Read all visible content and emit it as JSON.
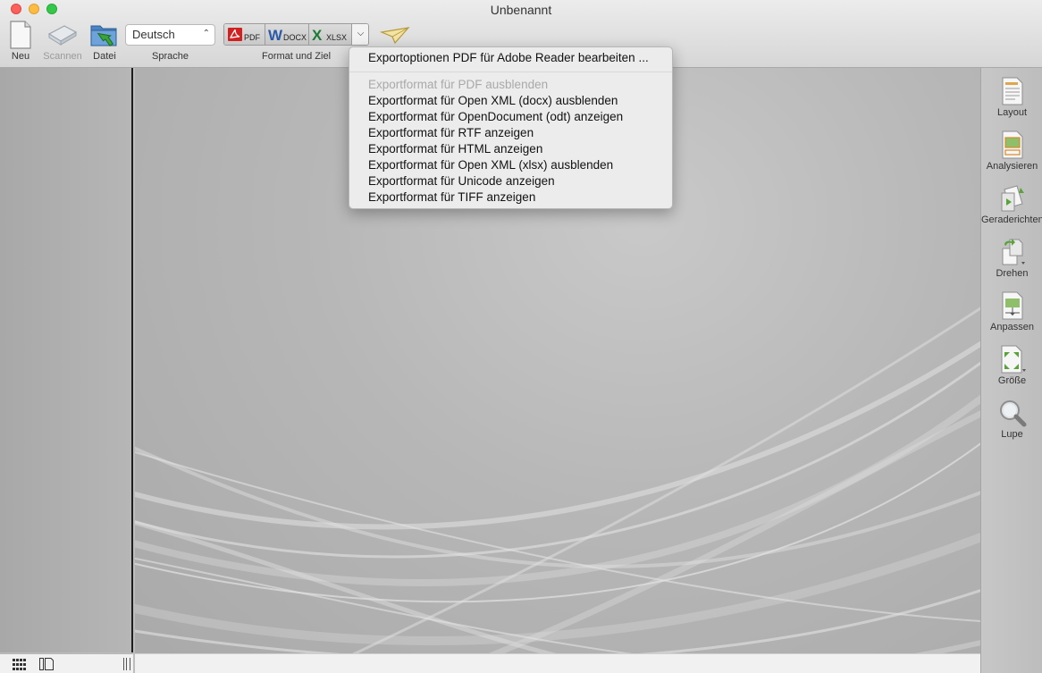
{
  "window": {
    "title": "Unbenannt"
  },
  "toolbar": {
    "new_label": "Neu",
    "scan_label": "Scannen",
    "file_label": "Datei",
    "language_value": "Deutsch",
    "language_label": "Sprache",
    "format_label": "Format und Ziel",
    "formats": [
      "PDF",
      "DOCX",
      "XLSX"
    ]
  },
  "menu": {
    "items": [
      {
        "label": "Exportoptionen PDF für Adobe Reader bearbeiten ...",
        "enabled": true
      },
      {
        "label": "Exportformat für PDF ausblenden",
        "enabled": false
      },
      {
        "label": "Exportformat für Open XML (docx) ausblenden",
        "enabled": true
      },
      {
        "label": "Exportformat für OpenDocument (odt) anzeigen",
        "enabled": true
      },
      {
        "label": "Exportformat für RTF anzeigen",
        "enabled": true
      },
      {
        "label": "Exportformat für HTML anzeigen",
        "enabled": true
      },
      {
        "label": "Exportformat für Open XML (xlsx) ausblenden",
        "enabled": true
      },
      {
        "label": "Exportformat für Unicode anzeigen",
        "enabled": true
      },
      {
        "label": "Exportformat für TIFF anzeigen",
        "enabled": true
      }
    ]
  },
  "tools": [
    {
      "label": "Layout",
      "icon": "layout-icon"
    },
    {
      "label": "Analysieren",
      "icon": "analyze-icon"
    },
    {
      "label": "Geraderichten",
      "icon": "straighten-icon"
    },
    {
      "label": "Drehen",
      "icon": "rotate-icon"
    },
    {
      "label": "Anpassen",
      "icon": "adjust-icon"
    },
    {
      "label": "Größe",
      "icon": "resize-icon"
    },
    {
      "label": "Lupe",
      "icon": "magnifier-icon"
    }
  ],
  "colors": {
    "pdf_red": "#d21f1f",
    "word_blue": "#2b5ba8",
    "excel_green": "#1d7a35"
  }
}
